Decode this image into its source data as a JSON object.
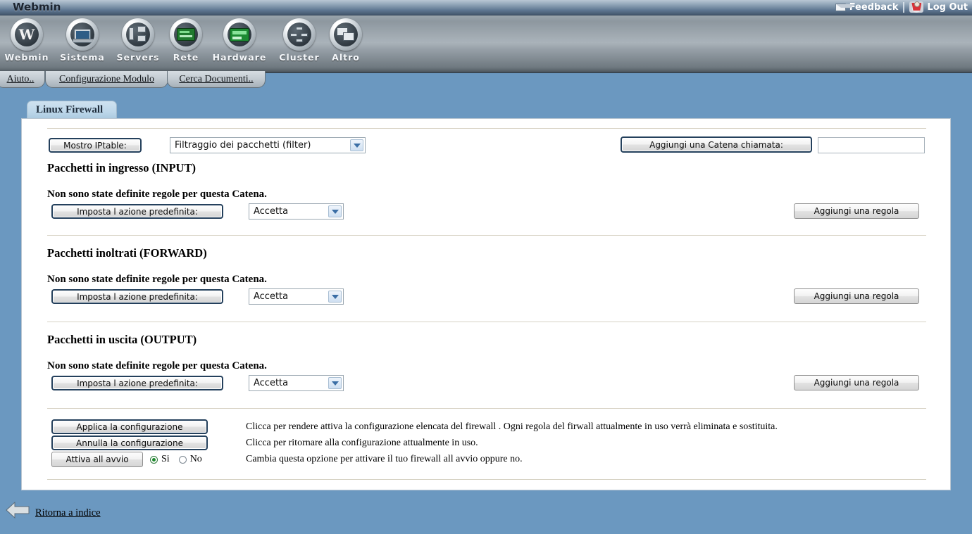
{
  "titlebar": {
    "title": "Webmin",
    "feedback": "Feedback",
    "logout": "Log Out"
  },
  "categories": [
    {
      "label": "Webmin",
      "icon": "webmin-icon"
    },
    {
      "label": "Sistema",
      "icon": "system-icon"
    },
    {
      "label": "Servers",
      "icon": "servers-icon"
    },
    {
      "label": "Rete",
      "icon": "network-icon"
    },
    {
      "label": "Hardware",
      "icon": "hardware-icon"
    },
    {
      "label": "Cluster",
      "icon": "cluster-icon"
    },
    {
      "label": "Altro",
      "icon": "others-icon"
    }
  ],
  "module_tabs": [
    {
      "label": "Aiuto.."
    },
    {
      "label": "Configurazione Modulo"
    },
    {
      "label": "Cerca Documenti.."
    }
  ],
  "page_tab": {
    "label": "Linux Firewall"
  },
  "toolbar": {
    "show_iptable_button": "Mostro IPtable:",
    "table_select_value": "Filtraggio dei pacchetti (filter)",
    "add_chain_button": "Aggiungi una Catena chiamata:",
    "add_chain_input_value": ""
  },
  "chains": [
    {
      "title": "Pacchetti in ingresso (INPUT)",
      "note": "Non sono state definite regole per questa Catena.",
      "set_default_button": "Imposta l azione predefinita:",
      "policy_value": "Accetta",
      "add_rule_button": "Aggiungi una regola"
    },
    {
      "title": "Pacchetti inoltrati (FORWARD)",
      "note": "Non sono state definite regole per questa Catena.",
      "set_default_button": "Imposta l azione predefinita:",
      "policy_value": "Accetta",
      "add_rule_button": "Aggiungi una regola"
    },
    {
      "title": "Pacchetti in uscita (OUTPUT)",
      "note": "Non sono state definite regole per questa Catena.",
      "set_default_button": "Imposta l azione predefinita:",
      "policy_value": "Accetta",
      "add_rule_button": "Aggiungi una regola"
    }
  ],
  "actions": [
    {
      "button": "Applica la configurazione",
      "desc": "Clicca per rendere attiva la configurazione elencata del firewall . Ogni regola del firwall attualmente in uso verrà eliminata e sostituita."
    },
    {
      "button": "Annulla la configurazione",
      "desc": "Clicca per ritornare alla configurazione attualmente in uso."
    },
    {
      "button": "Attiva all avvio",
      "desc": "Cambia questa opzione per attivare il tuo firewall all avvio oppure no."
    }
  ],
  "boot_radio": {
    "yes_label": "Si",
    "no_label": "No",
    "selected": "Si"
  },
  "footer": {
    "back_link": "Ritorna a indice"
  },
  "colors": {
    "page_background": "#6b98c0",
    "panel_background": "#ffffff",
    "accent_border": "#24405c",
    "radio_on": "#1f8a2e"
  }
}
